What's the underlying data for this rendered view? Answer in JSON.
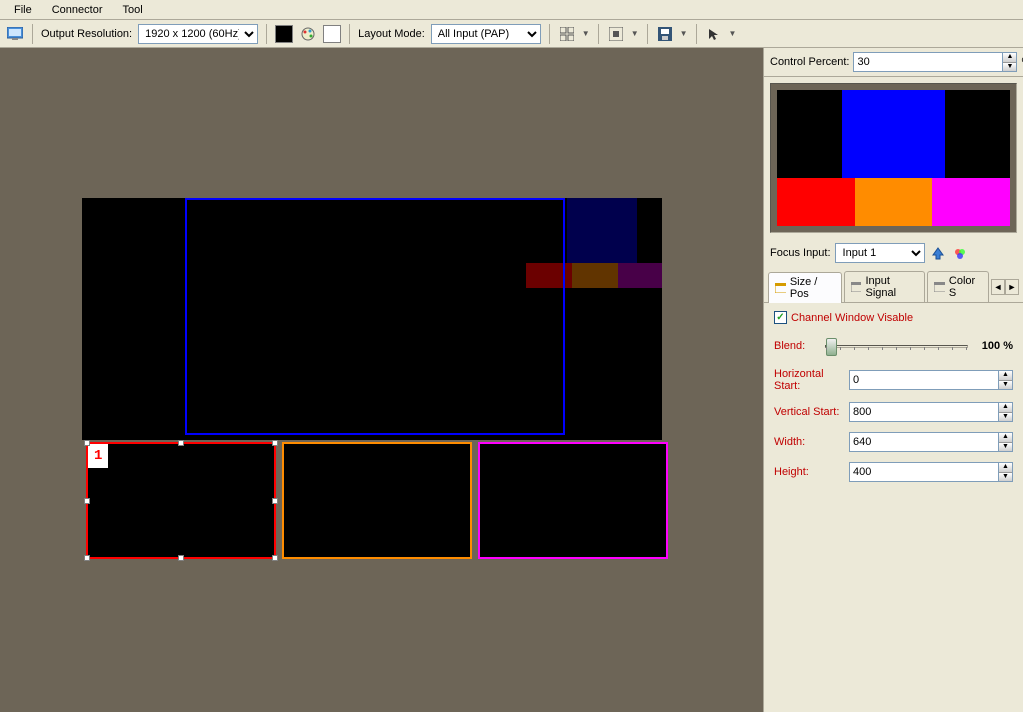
{
  "menu": {
    "items": [
      "File",
      "Connector",
      "Tool"
    ]
  },
  "toolbar": {
    "output_res_label": "Output Resolution:",
    "output_res_value": "1920 x 1200 (60Hz)",
    "layout_mode_label": "Layout Mode:",
    "layout_mode_value": "All Input (PAP)"
  },
  "side": {
    "control_percent_label": "Control Percent:",
    "control_percent_value": "30",
    "percent_sign": "%",
    "focus_input_label": "Focus Input:",
    "focus_input_value": "Input 1",
    "tabs": {
      "size_pos": "Size / Pos",
      "input_signal": "Input Signal",
      "color": "Color S"
    },
    "channel_visible_label": "Channel Window Visable",
    "blend_label": "Blend:",
    "blend_value": "100 %",
    "fields": {
      "hstart_label": "Horizontal Start:",
      "hstart": "0",
      "vstart_label": "Vertical Start:",
      "vstart": "800",
      "width_label": "Width:",
      "width": "640",
      "height_label": "Height:",
      "height": "400"
    }
  },
  "canvas": {
    "sel_label": "1"
  }
}
